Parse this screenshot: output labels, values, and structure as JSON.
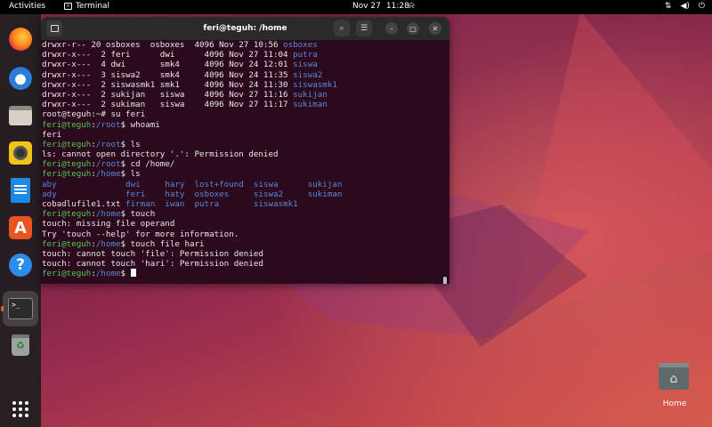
{
  "topbar": {
    "activities": "Activities",
    "app_name": "Terminal",
    "date": "Nov 27",
    "time": "11:28"
  },
  "dock": {
    "apps": [
      "firefox",
      "thunderbird",
      "files",
      "rhythmbox",
      "libreoffice-writer",
      "ubuntu-software",
      "help",
      "terminal",
      "trash",
      "show-apps"
    ]
  },
  "terminal": {
    "title": "feri@teguh: /home",
    "lines": [
      {
        "segs": [
          {
            "t": "drwxr-r-- 20 osboxes  osboxes  4096 Nov 27 10:56 ",
            "c": "w"
          },
          {
            "t": "osboxes",
            "c": "b"
          }
        ]
      },
      {
        "segs": [
          {
            "t": "drwxr-x---  2 feri      dwi      4096 Nov 27 11:04 ",
            "c": "w"
          },
          {
            "t": "putra",
            "c": "b"
          }
        ]
      },
      {
        "segs": [
          {
            "t": "drwxr-x---  4 dwi       smk4     4096 Nov 24 12:01 ",
            "c": "w"
          },
          {
            "t": "siswa",
            "c": "b"
          }
        ]
      },
      {
        "segs": [
          {
            "t": "drwxr-x---  3 siswa2    smk4     4096 Nov 24 11:35 ",
            "c": "w"
          },
          {
            "t": "siswa2",
            "c": "b"
          }
        ]
      },
      {
        "segs": [
          {
            "t": "drwxr-x---  2 siswasmk1 smk1     4096 Nov 24 11:30 ",
            "c": "w"
          },
          {
            "t": "siswasmk1",
            "c": "b"
          }
        ]
      },
      {
        "segs": [
          {
            "t": "drwxr-x---  2 sukijan   siswa    4096 Nov 27 11:16 ",
            "c": "w"
          },
          {
            "t": "sukijan",
            "c": "b"
          }
        ]
      },
      {
        "segs": [
          {
            "t": "drwxr-x---  2 sukiman   siswa    4096 Nov 27 11:17 ",
            "c": "w"
          },
          {
            "t": "sukiman",
            "c": "b"
          }
        ]
      },
      {
        "segs": [
          {
            "t": "root@teguh:~# su feri",
            "c": "w"
          }
        ]
      },
      {
        "segs": [
          {
            "t": "feri@teguh",
            "c": "g"
          },
          {
            "t": ":",
            "c": "w"
          },
          {
            "t": "/root",
            "c": "b"
          },
          {
            "t": "$ whoami",
            "c": "w"
          }
        ]
      },
      {
        "segs": [
          {
            "t": "feri",
            "c": "w"
          }
        ]
      },
      {
        "segs": [
          {
            "t": "feri@teguh",
            "c": "g"
          },
          {
            "t": ":",
            "c": "w"
          },
          {
            "t": "/root",
            "c": "b"
          },
          {
            "t": "$ ls",
            "c": "w"
          }
        ]
      },
      {
        "segs": [
          {
            "t": "ls: cannot open directory '.': Permission denied",
            "c": "w"
          }
        ]
      },
      {
        "segs": [
          {
            "t": "feri@teguh",
            "c": "g"
          },
          {
            "t": ":",
            "c": "w"
          },
          {
            "t": "/root",
            "c": "b"
          },
          {
            "t": "$ cd /home/",
            "c": "w"
          }
        ]
      },
      {
        "segs": [
          {
            "t": "feri@teguh",
            "c": "g"
          },
          {
            "t": ":",
            "c": "w"
          },
          {
            "t": "/home",
            "c": "b"
          },
          {
            "t": "$ ls",
            "c": "w"
          }
        ]
      },
      {
        "segs": [
          {
            "t": "aby              dwi     hary  lost+found  siswa      sukijan",
            "c": "b"
          }
        ]
      },
      {
        "segs": [
          {
            "t": "ady              feri    haty  osboxes     siswa2     sukiman",
            "c": "b"
          }
        ]
      },
      {
        "segs": [
          {
            "t": "cobadlufile1.txt ",
            "c": "w"
          },
          {
            "t": "firman  iwan  putra       siswasmk1",
            "c": "b"
          }
        ]
      },
      {
        "segs": [
          {
            "t": "feri@teguh",
            "c": "g"
          },
          {
            "t": ":",
            "c": "w"
          },
          {
            "t": "/home",
            "c": "b"
          },
          {
            "t": "$ touch",
            "c": "w"
          }
        ]
      },
      {
        "segs": [
          {
            "t": "touch: missing file operand",
            "c": "w"
          }
        ]
      },
      {
        "segs": [
          {
            "t": "Try 'touch --help' for more information.",
            "c": "w"
          }
        ]
      },
      {
        "segs": [
          {
            "t": "feri@teguh",
            "c": "g"
          },
          {
            "t": ":",
            "c": "w"
          },
          {
            "t": "/home",
            "c": "b"
          },
          {
            "t": "$ touch file hari",
            "c": "w"
          }
        ]
      },
      {
        "segs": [
          {
            "t": "touch: cannot touch 'file': Permission denied",
            "c": "w"
          }
        ]
      },
      {
        "segs": [
          {
            "t": "touch: cannot touch 'hari': Permission denied",
            "c": "w"
          }
        ]
      },
      {
        "segs": [
          {
            "t": "feri@teguh",
            "c": "g"
          },
          {
            "t": ":",
            "c": "w"
          },
          {
            "t": "/home",
            "c": "b"
          },
          {
            "t": "$ ",
            "c": "w"
          }
        ],
        "cursor": true
      }
    ]
  },
  "desktop": {
    "home_label": "Home"
  },
  "colors": {
    "prompt_user": "#4ec94e",
    "prompt_path": "#5a87d6",
    "terminal_bg": "#2c0a1e",
    "accent": "#e95420"
  }
}
